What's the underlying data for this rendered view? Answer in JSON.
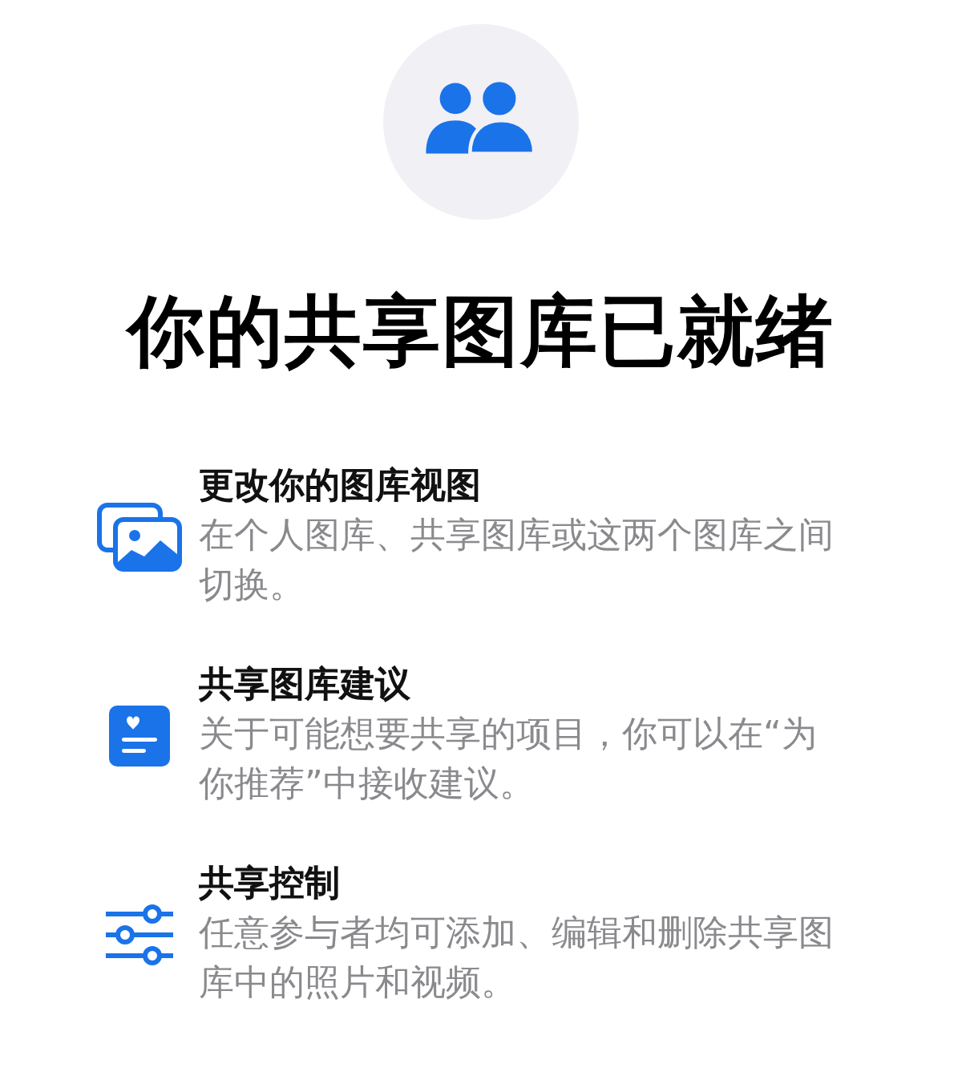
{
  "title": "你的共享图库已就绪",
  "features": [
    {
      "kind": "photos",
      "title": "更改你的图库视图",
      "description": "在个人图库、共享图库或这两个图库之间切换。"
    },
    {
      "kind": "suggestion",
      "title": "共享图库建议",
      "description": "关于可能想要共享的项目，你可以在“为你推荐”中接收建议。"
    },
    {
      "kind": "controls",
      "title": "共享控制",
      "description": "任意参与者均可添加、编辑和删除共享图库中的照片和视频。"
    }
  ]
}
